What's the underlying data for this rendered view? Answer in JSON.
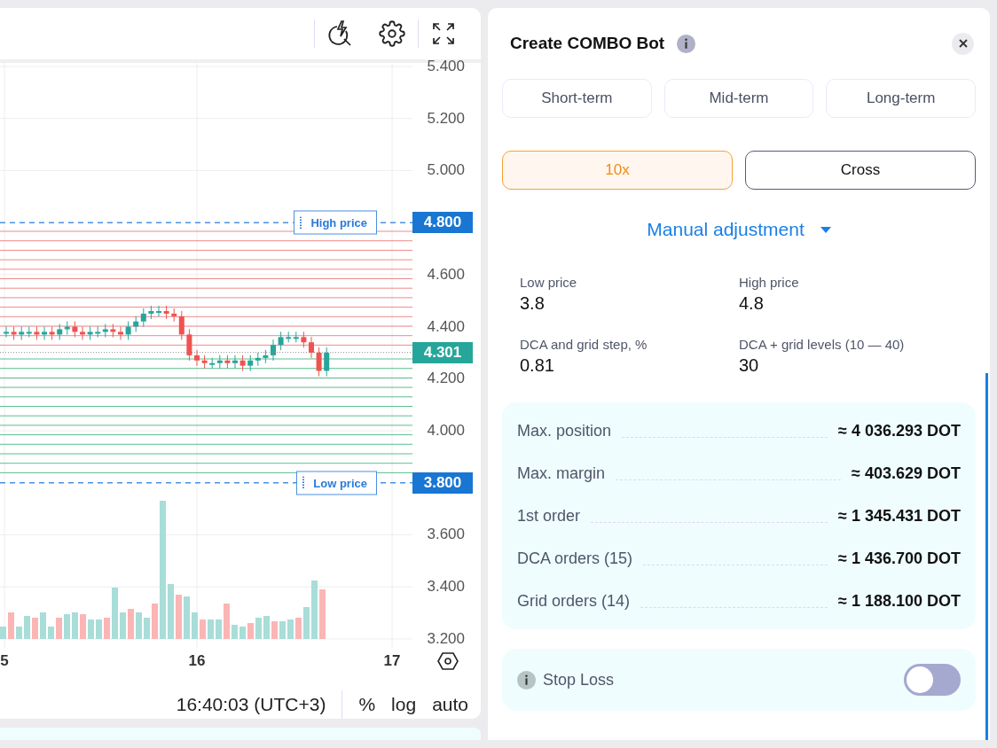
{
  "chart": {
    "y_ticks": [
      "5.400",
      "5.200",
      "5.000",
      "4.600",
      "4.400",
      "4.200",
      "4.000",
      "3.600",
      "3.400",
      "3.200"
    ],
    "price_markers": [
      {
        "kind": "limit",
        "label": "High price",
        "price": "4.800"
      },
      {
        "kind": "current",
        "price": "4.301"
      },
      {
        "kind": "limit",
        "label": "Low price",
        "price": "3.800"
      }
    ],
    "x_ticks": [
      "5",
      "16",
      "17"
    ]
  },
  "chart_footer": {
    "time": "16:40:03 (UTC+3)",
    "options": [
      "%",
      "log",
      "auto"
    ]
  },
  "panel": {
    "title": "Create COMBO Bot",
    "term_tabs": [
      {
        "label": "Short-term",
        "selected": false
      },
      {
        "label": "Mid-term",
        "selected": false
      },
      {
        "label": "Long-term",
        "selected": false
      }
    ],
    "margin_options": [
      {
        "label": "10x",
        "selected": true
      },
      {
        "label": "Cross",
        "selected": false
      }
    ],
    "mode": "Manual adjustment",
    "fields": [
      {
        "label": "Low price",
        "value": "3.8"
      },
      {
        "label": "High price",
        "value": "4.8"
      },
      {
        "label": "DCA and grid step, %",
        "value": "0.81"
      },
      {
        "label": "DCA + grid levels (10 — 40)",
        "value": "30"
      }
    ],
    "summary": [
      {
        "label": "Max. position",
        "value": "≈ 4 036.293 DOT"
      },
      {
        "label": "Max. margin",
        "value": "≈ 403.629 DOT"
      },
      {
        "label": "1st order",
        "value": "≈ 1 345.431 DOT"
      },
      {
        "label": "DCA orders (15)",
        "value": "≈ 1 436.700 DOT"
      },
      {
        "label": "Grid orders (14)",
        "value": "≈ 1 188.100 DOT"
      }
    ],
    "stop_loss": {
      "label": "Stop Loss",
      "on": false
    }
  }
}
